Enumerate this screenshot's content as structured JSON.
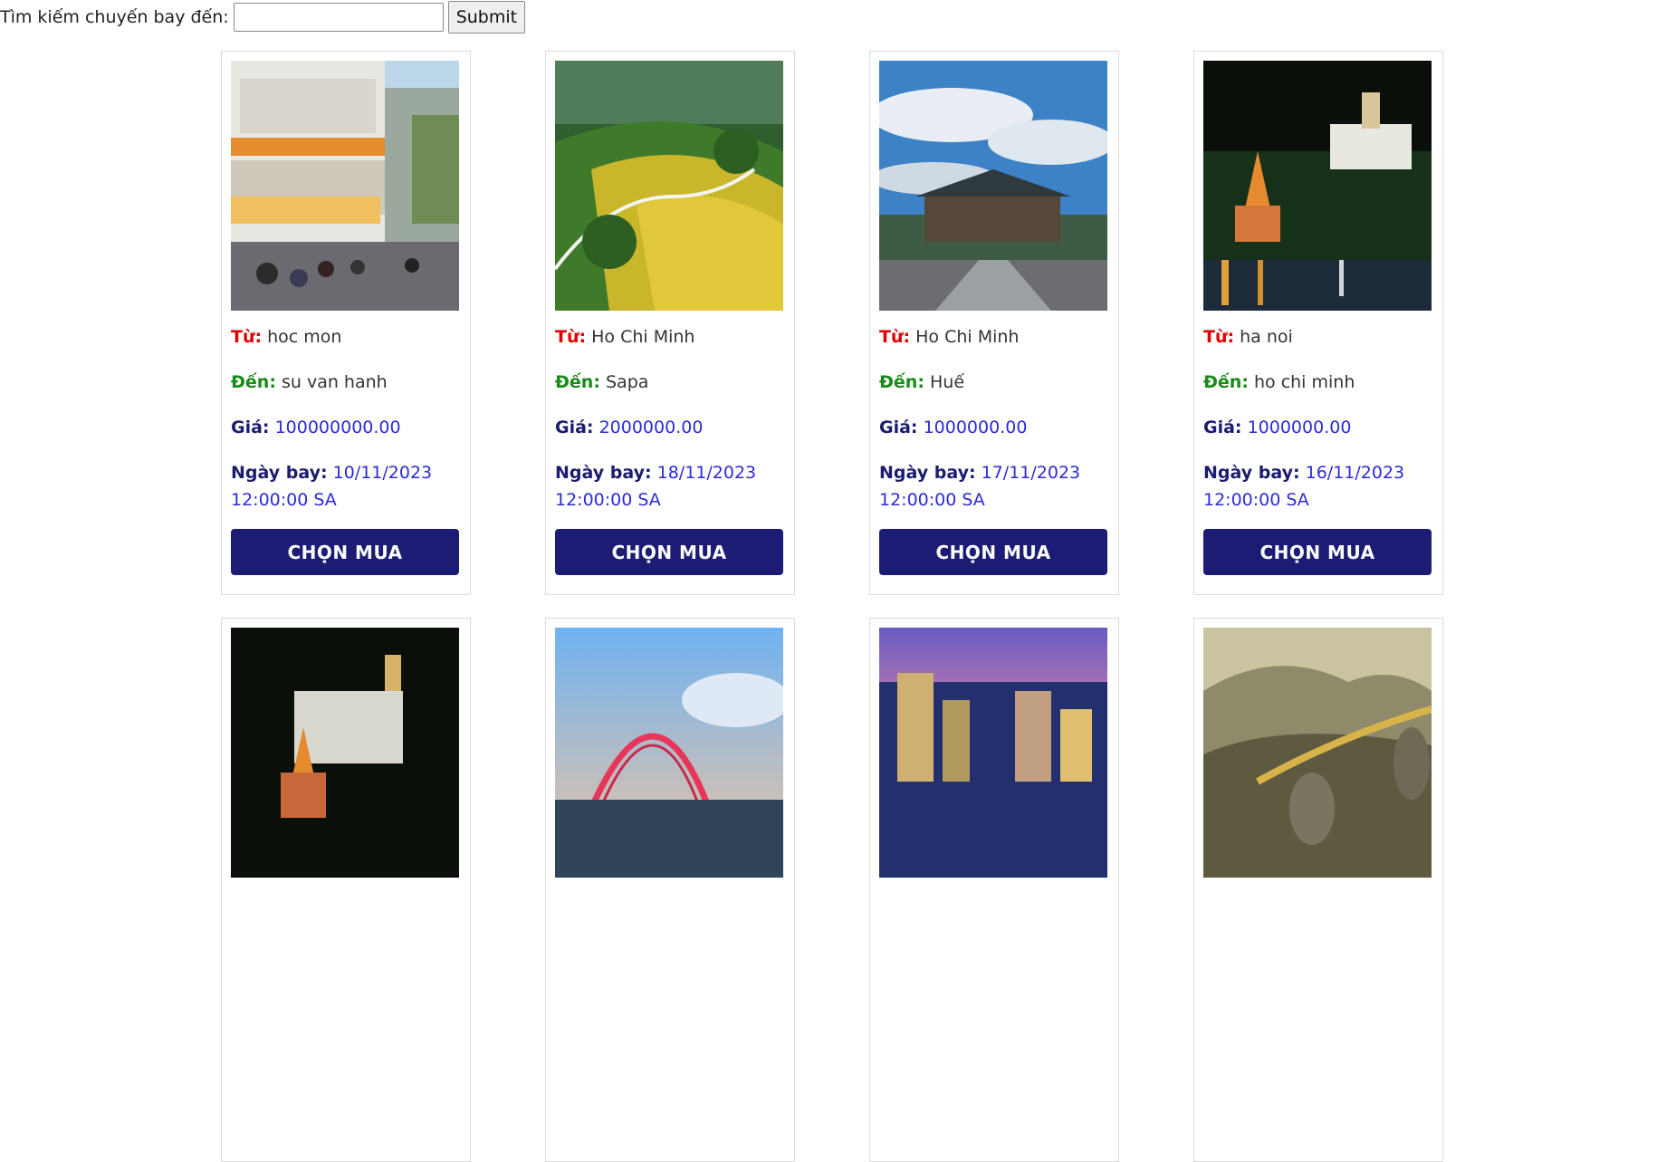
{
  "search": {
    "label": "Tìm kiếm chuyến bay đến:",
    "value": "",
    "placeholder": "",
    "submit_label": "Submit"
  },
  "card_labels": {
    "from": "Từ:",
    "to": "Đến:",
    "price": "Giá:",
    "date": "Ngày bay:",
    "buy": "CHỌN MUA"
  },
  "flights": [
    {
      "from": "hoc mon",
      "to": "su van hanh",
      "price": "100000000.00",
      "date_line1": "10/11/2023",
      "date_line2": "12:00:00 SA",
      "photo": "street-photo"
    },
    {
      "from": "Ho Chi Minh",
      "to": "Sapa",
      "price": "2000000.00",
      "date_line1": "18/11/2023",
      "date_line2": "12:00:00 SA",
      "photo": "rice-terrace-photo"
    },
    {
      "from": "Ho Chi Minh",
      "to": "Huế",
      "price": "1000000.00",
      "date_line1": "17/11/2023",
      "date_line2": "12:00:00 SA",
      "photo": "hue-citadel-photo"
    },
    {
      "from": "ha noi",
      "to": "ho chi minh",
      "price": "1000000.00",
      "date_line1": "16/11/2023",
      "date_line2": "12:00:00 SA",
      "photo": "hanoi-night-photo"
    }
  ],
  "second_row_photos": [
    "hanoi-night-photo",
    "bridge-photo",
    "city-night-photo",
    "golden-bridge-photo"
  ],
  "colors": {
    "from_label": "#e00000",
    "to_label": "#1a8a1a",
    "navy": "#1c1c74",
    "value_blue": "#2b2bd8"
  }
}
